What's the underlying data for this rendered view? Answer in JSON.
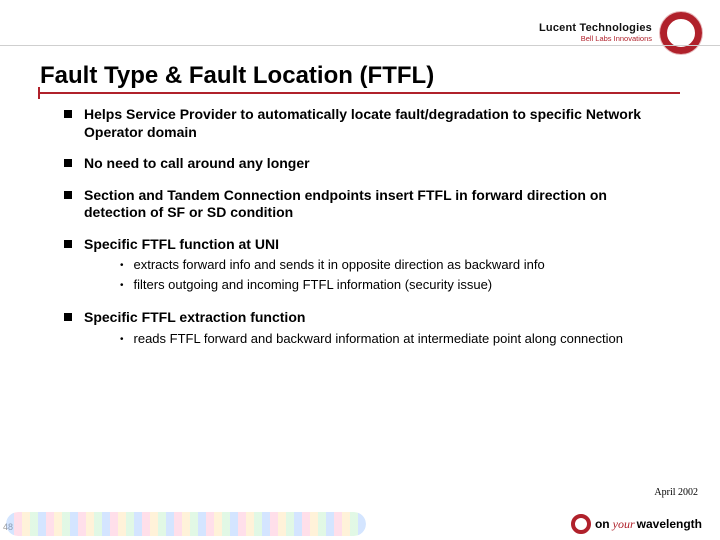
{
  "brand": {
    "name": "Lucent Technologies",
    "sub": "Bell Labs Innovations"
  },
  "title": "Fault Type & Fault Location (FTFL)",
  "bullets": [
    {
      "text": "Helps Service Provider to automatically locate fault/degradation to specific Network Operator domain"
    },
    {
      "text": "No need to call around any longer"
    },
    {
      "text": "Section and Tandem Connection endpoints insert FTFL in forward direction on detection of SF or SD condition"
    },
    {
      "text": "Specific FTFL function at UNI",
      "sub": [
        "extracts forward info and sends it in opposite direction as backward info",
        "filters outgoing and incoming FTFL information (security issue)"
      ]
    },
    {
      "text": "Specific FTFL extraction function",
      "sub": [
        "reads FTFL forward and backward information at intermediate point along connection"
      ]
    }
  ],
  "footer": {
    "date": "April 2002",
    "page": "48",
    "mark_on": "on",
    "mark_your": "your",
    "mark_wl": "wavelength"
  }
}
